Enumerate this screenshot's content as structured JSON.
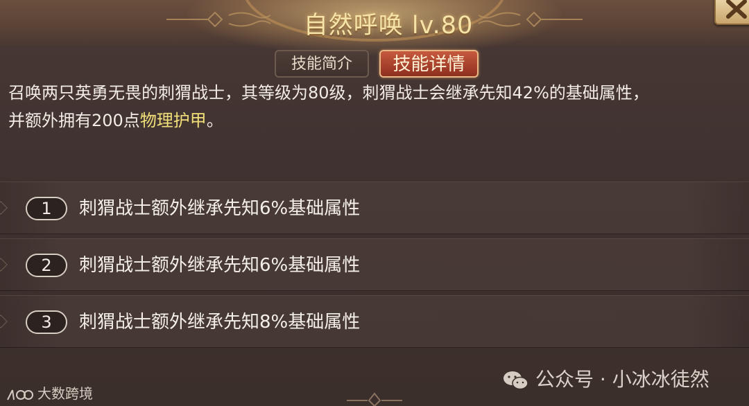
{
  "header": {
    "title": "自然呼唤 lv.80"
  },
  "tabs": [
    {
      "label": "技能简介",
      "active": false
    },
    {
      "label": "技能详情",
      "active": true
    }
  ],
  "description": {
    "line1": "召唤两只英勇无畏的刺猬战士，其等级为80级，刺猬战士会继承先知42%的基础属性，",
    "line2_prefix": "并额外拥有200点",
    "line2_keyword": "物理护甲",
    "line2_suffix": "。"
  },
  "upgrades": [
    {
      "number": "1",
      "text": "刺猬战士额外继承先知6%基础属性"
    },
    {
      "number": "2",
      "text": "刺猬战士额外继承先知6%基础属性"
    },
    {
      "number": "3",
      "text": "刺猬战士额外继承先知8%基础属性"
    }
  ],
  "watermarks": {
    "left": "大数跨境",
    "right": "公众号 · 小冰冰徒然"
  },
  "colors": {
    "title": "#f6e3a8",
    "keyword": "#f2e07a",
    "active_tab": "#c65a3e"
  },
  "icons": {
    "close": "close-icon",
    "wechat": "wechat-icon",
    "logo": "brand-logo"
  }
}
